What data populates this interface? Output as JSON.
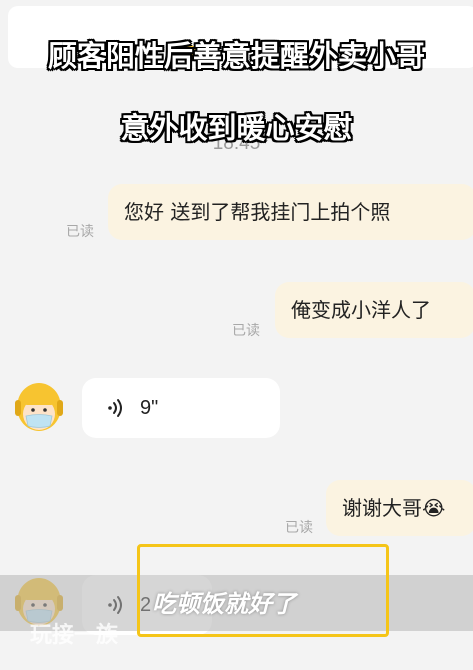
{
  "headline": {
    "line1": "顾客阳性后善意提醒外卖小哥",
    "line2": "意外收到暖心安慰"
  },
  "chat": {
    "time": "18:45",
    "messages": [
      {
        "side": "right",
        "text": "您好 送到了帮我挂门上拍个照",
        "status": "已读"
      },
      {
        "side": "right",
        "text": "俺变成小洋人了",
        "status": "已读"
      },
      {
        "side": "left",
        "type": "voice",
        "duration": "9\""
      },
      {
        "side": "right",
        "text": "谢谢大哥😭",
        "status": "已读"
      },
      {
        "side": "left",
        "type": "voice",
        "duration": "2"
      }
    ]
  },
  "overlay": {
    "subtitle": "吃顿饭就好了",
    "watermark_bottom": "玩接一族",
    "watermark_mid": "玩接"
  },
  "colors": {
    "background": "#f3f3f3",
    "bubble_right": "#fbf3e1",
    "bubble_left": "#ffffff",
    "highlight": "#f5c518",
    "avatar_helmet": "#f7c430"
  },
  "icons": {
    "voice": "voice-wave-icon",
    "avatar": "delivery-rider-avatar"
  }
}
